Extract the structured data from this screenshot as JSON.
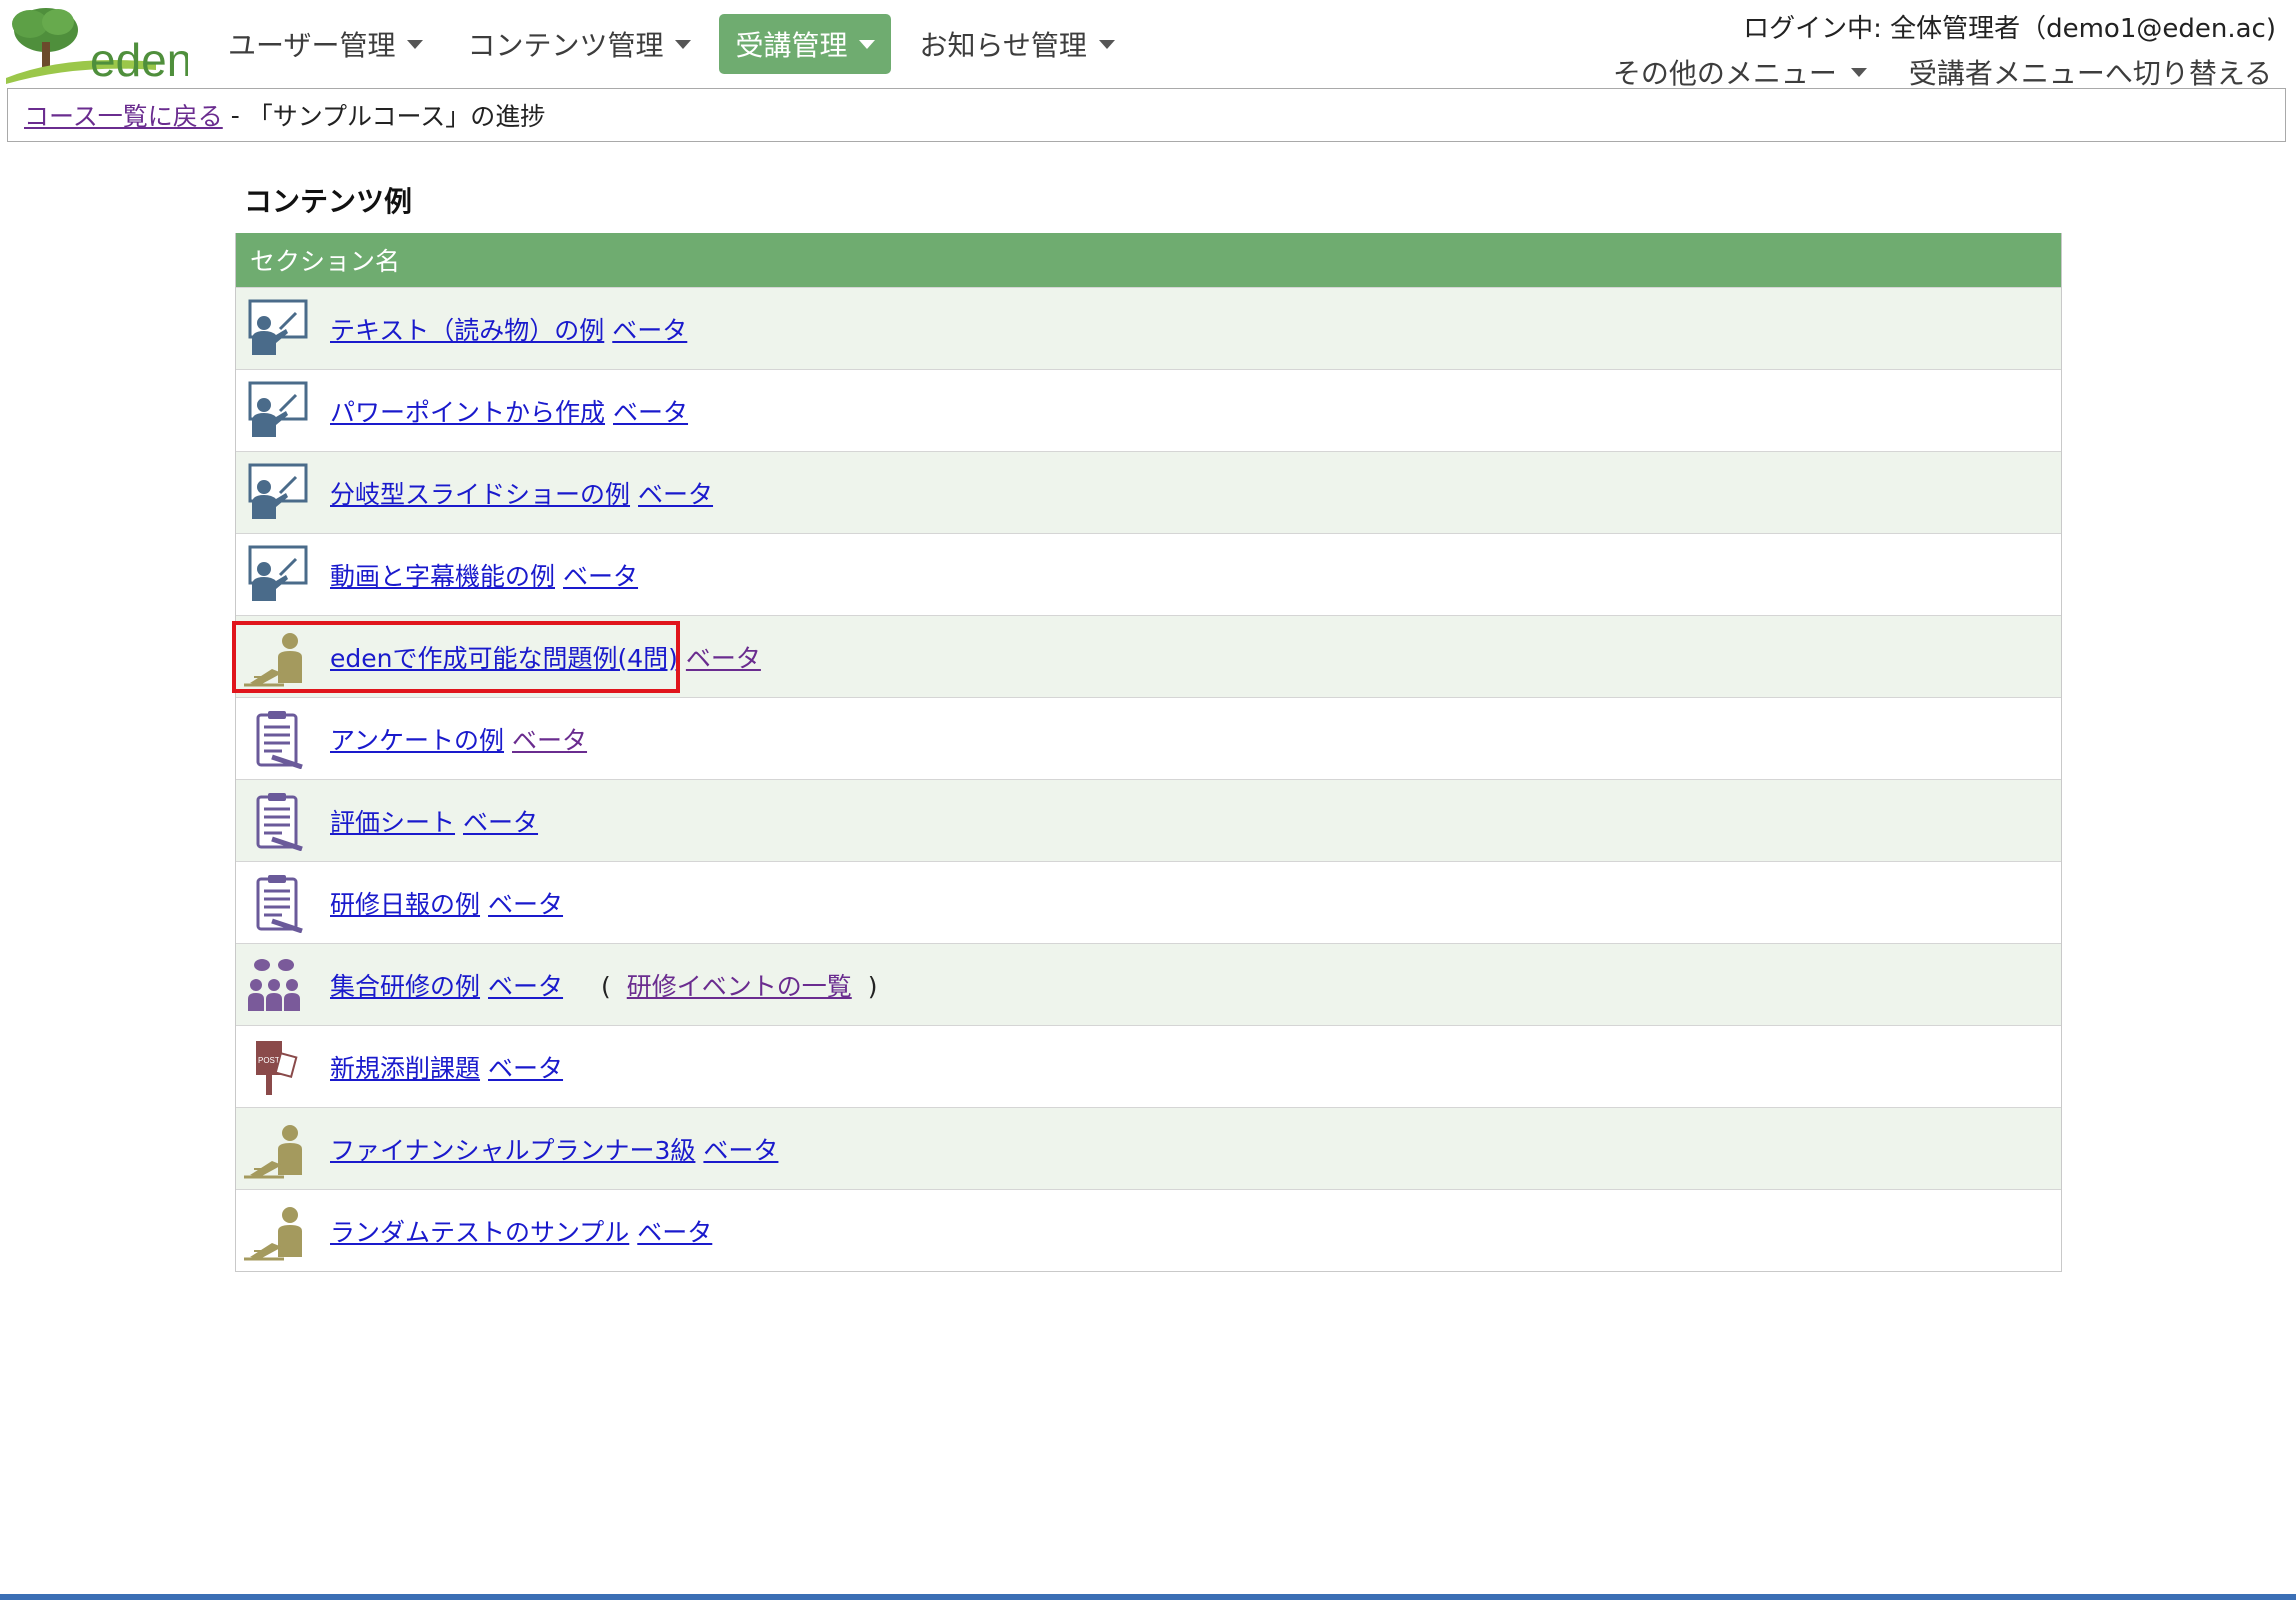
{
  "brand": {
    "logo_text": "eden"
  },
  "nav": [
    {
      "label": "ユーザー管理",
      "active": false
    },
    {
      "label": "コンテンツ管理",
      "active": false
    },
    {
      "label": "受講管理",
      "active": true
    },
    {
      "label": "お知らせ管理",
      "active": false
    }
  ],
  "header": {
    "login": "ログイン中: 全体管理者（demo1@eden.ac)",
    "other_menu": "その他のメニュー",
    "switch_menu": "受講者メニューへ切り替える"
  },
  "breadcrumb": {
    "back_link": "コース一覧に戻る",
    "separator": "-",
    "current": "「サンプルコース」の進捗"
  },
  "content": {
    "title": "コンテンツ例",
    "table_header": "セクション名",
    "rows": [
      {
        "icon": "lecture-icon",
        "title": "テキスト（読み物）の例",
        "beta": "ベータ"
      },
      {
        "icon": "lecture-icon",
        "title": "パワーポイントから作成",
        "beta": "ベータ"
      },
      {
        "icon": "lecture-icon",
        "title": "分岐型スライドショーの例",
        "beta": "ベータ"
      },
      {
        "icon": "lecture-icon",
        "title": "動画と字幕機能の例",
        "beta": "ベータ"
      },
      {
        "icon": "exam-icon",
        "title": "edenで作成可能な問題例(4問)",
        "beta": "ベータ",
        "highlighted": true
      },
      {
        "icon": "survey-icon",
        "title": "アンケートの例",
        "beta": "ベータ"
      },
      {
        "icon": "survey-icon",
        "title": "評価シート",
        "beta": "ベータ"
      },
      {
        "icon": "survey-icon",
        "title": "研修日報の例",
        "beta": "ベータ"
      },
      {
        "icon": "group-training-icon",
        "title": "集合研修の例",
        "beta": "ベータ",
        "extra_open": "(",
        "extra_link": "研修イベントの一覧",
        "extra_close": ")"
      },
      {
        "icon": "post-icon",
        "title": "新規添削課題",
        "beta": "ベータ"
      },
      {
        "icon": "exam-icon",
        "title": "ファイナンシャルプランナー3級",
        "beta": "ベータ"
      },
      {
        "icon": "exam-icon",
        "title": "ランダムテストのサンプル",
        "beta": "ベータ"
      }
    ]
  },
  "colors": {
    "accent": "#6fac70",
    "link": "#1a1acc",
    "visited": "#6a2c8f",
    "highlight": "#e0151c"
  }
}
